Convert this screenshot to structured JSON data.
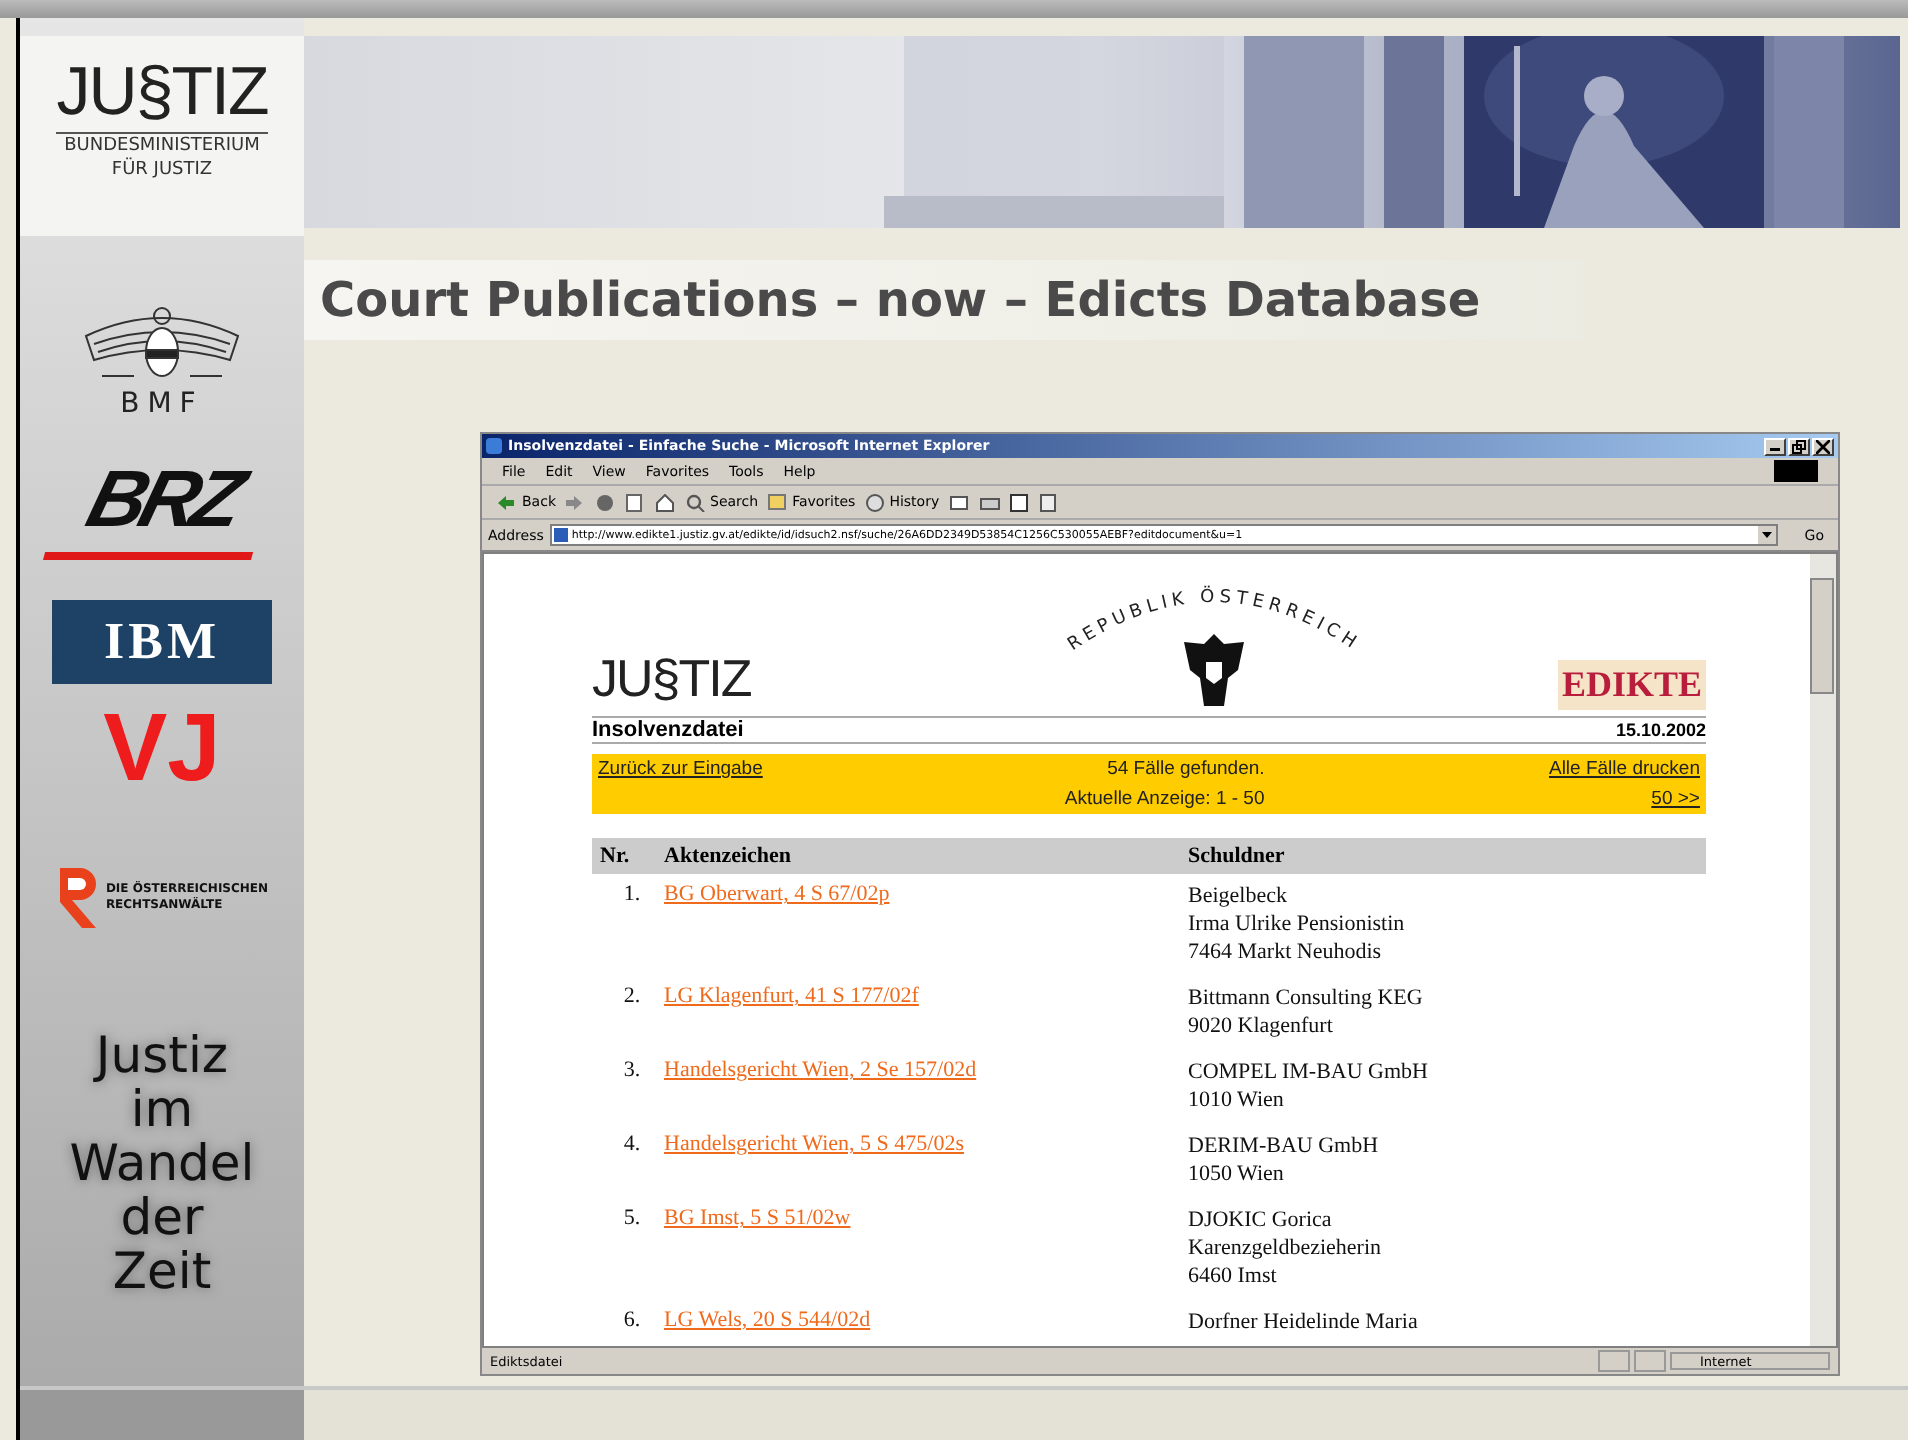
{
  "slide": {
    "title": "Court Publications – now – Edicts Database",
    "logos": [
      {
        "kind": "justiz",
        "text": "JU§TIZ",
        "lines": [
          "BUNDESMINISTERIUM",
          "FÜR JUSTIZ"
        ]
      },
      {
        "kind": "bmf",
        "text": "BMF"
      },
      {
        "kind": "brz",
        "text": "BRZ"
      },
      {
        "kind": "ibm",
        "text": "IBM"
      },
      {
        "kind": "vj",
        "text": "VJ"
      },
      {
        "kind": "anwaelte",
        "lines": [
          "DIE ÖSTERREICHISCHEN",
          "RECHTSANWÄLTE"
        ]
      }
    ],
    "tagline": [
      "Justiz",
      "im",
      "Wandel",
      "der",
      "Zeit"
    ]
  },
  "browser": {
    "title": "Insolvenzdatei - Einfache Suche - Microsoft Internet Explorer",
    "menu": [
      "File",
      "Edit",
      "View",
      "Favorites",
      "Tools",
      "Help"
    ],
    "toolbar": [
      {
        "kind": "back",
        "label": "Back"
      },
      {
        "kind": "forward"
      },
      {
        "kind": "stop"
      },
      {
        "kind": "refresh"
      },
      {
        "kind": "home"
      },
      {
        "kind": "search",
        "label": "Search"
      },
      {
        "kind": "favorites",
        "label": "Favorites"
      },
      {
        "kind": "history",
        "label": "History"
      },
      {
        "kind": "mail"
      },
      {
        "kind": "print"
      },
      {
        "kind": "edit"
      },
      {
        "kind": "discuss"
      }
    ],
    "address": {
      "label": "Address",
      "value": "http://www.edikte1.justiz.gv.at/edikte/id/idsuch2.nsf/suche/26A6DD2349D53854C1256C530055AEBF?editdocument&u=1",
      "go": "Go"
    },
    "page": {
      "logo": "JU§TIZ",
      "arc": "REPUBLIK ÖSTERREICH",
      "badge": "EDIKTE",
      "heading": "Insolvenzdatei",
      "date": "15.10.2002",
      "bar": {
        "back_link": "Zurück zur Eingabe",
        "found": "54 Fälle gefunden.",
        "print_link": "Alle Fälle drucken",
        "range": "Aktuelle Anzeige: 1 - 50",
        "next_link": "50 >>"
      },
      "table": {
        "columns": [
          "Nr.",
          "Aktenzeichen",
          "Schuldner"
        ],
        "rows": [
          {
            "nr": "1.",
            "case": "BG Oberwart, 4 S 67/02p",
            "debtor": [
              "Beigelbeck",
              "Irma Ulrike Pensionistin",
              "7464 Markt Neuhodis"
            ]
          },
          {
            "nr": "2.",
            "case": "LG Klagenfurt, 41 S 177/02f",
            "debtor": [
              "Bittmann Consulting KEG",
              "9020 Klagenfurt"
            ]
          },
          {
            "nr": "3.",
            "case": "Handelsgericht Wien, 2 Se 157/02d",
            "debtor": [
              "COMPEL IM-BAU GmbH",
              "1010 Wien"
            ]
          },
          {
            "nr": "4.",
            "case": "Handelsgericht Wien, 5 S 475/02s",
            "debtor": [
              "DERIM-BAU GmbH",
              "1050 Wien"
            ]
          },
          {
            "nr": "5.",
            "case": "BG Imst, 5 S 51/02w",
            "debtor": [
              "DJOKIC Gorica",
              "Karenzgeldbezieherin",
              "6460 Imst"
            ]
          },
          {
            "nr": "6.",
            "case": "LG Wels, 20 S 544/02d",
            "debtor": [
              "Dorfner Heidelinde Maria"
            ]
          }
        ]
      }
    },
    "status": {
      "text": "Ediktsdatei",
      "zone": "Internet"
    }
  }
}
